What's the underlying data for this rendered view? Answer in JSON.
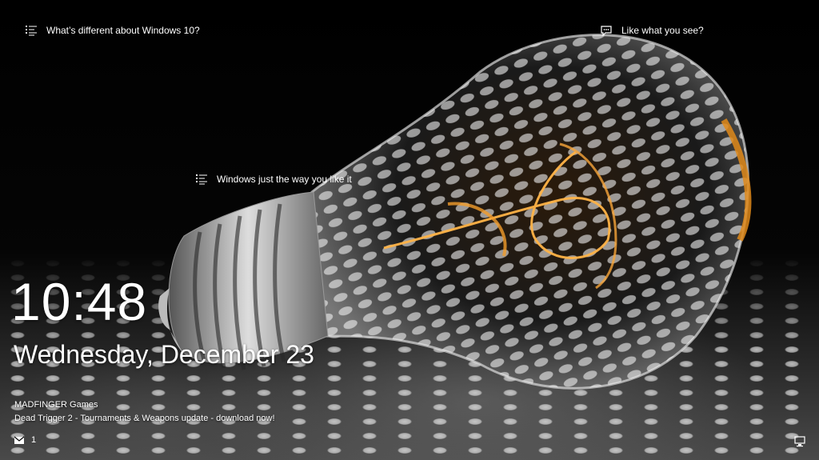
{
  "lock_screen": {
    "spotlight": {
      "top_left": {
        "icon": "list-icon",
        "text": "What’s different about Windows 10?"
      },
      "top_right": {
        "icon": "comment-icon",
        "text": "Like what you see?"
      },
      "hotspot": {
        "icon": "list-icon",
        "text": "Windows just the way you like it"
      }
    },
    "clock": {
      "time": "10:48",
      "date": "Wednesday, December 23"
    },
    "notification": {
      "app": "MADFINGER Games",
      "message": "Dead Trigger 2 - Tournaments & Weapons update - download now!"
    },
    "status": {
      "mail_icon": "mail-icon",
      "mail_count": "1",
      "network_icon": "network-icon"
    }
  }
}
